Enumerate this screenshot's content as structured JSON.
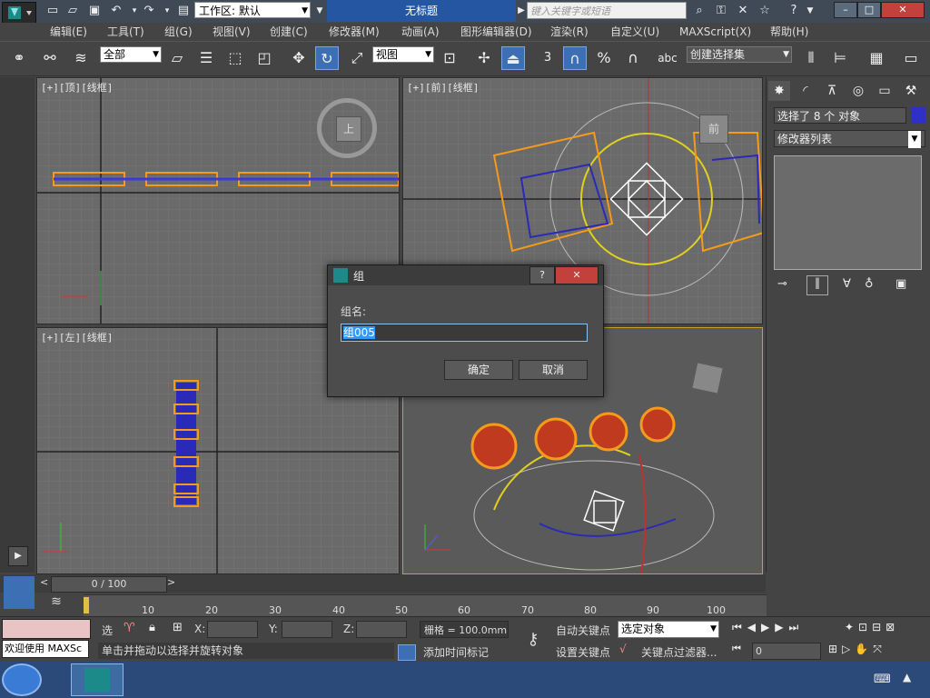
{
  "title_bar": {
    "workspace_label": "工作区: 默认",
    "window_title": "无标题",
    "search_placeholder": "键入关键字或短语",
    "minimize": "–",
    "maximize": "□",
    "close": "✕"
  },
  "menu": [
    "编辑(E)",
    "工具(T)",
    "组(G)",
    "视图(V)",
    "创建(C)",
    "修改器(M)",
    "动画(A)",
    "图形编辑器(D)",
    "渲染(R)",
    "自定义(U)",
    "MAXScript(X)",
    "帮助(H)"
  ],
  "toolbar": {
    "filter": "全部",
    "ref_coord": "视图",
    "selection_set": "创建选择集",
    "angle_snap": "3"
  },
  "viewports": {
    "top": "[+][顶][线框]",
    "front": "[+][前][线框]",
    "left": "[+][左][线框]",
    "viewcube_top": "上",
    "viewcube_front": "前"
  },
  "command_panel": {
    "selection_status": "选择了 8 个 对象",
    "modifier_list": "修改器列表"
  },
  "dialog": {
    "title": "组",
    "label": "组名:",
    "value": "组005",
    "ok": "确定",
    "cancel": "取消",
    "help": "?",
    "close": "✕"
  },
  "timeline": {
    "frame": "0 / 100",
    "ticks": [
      "10",
      "20",
      "30",
      "40",
      "50",
      "60",
      "70",
      "80",
      "90",
      "100"
    ]
  },
  "status_bar": {
    "welcome": "欢迎使用 MAXSc",
    "prompt": "单击并拖动以选择并旋转对象",
    "select_label": "选",
    "x_label": "X:",
    "y_label": "Y:",
    "z_label": "Z:",
    "grid": "栅格 = 100.0mm",
    "add_time_tag": "添加时间标记",
    "auto_key": "自动关键点",
    "set_key": "设置关键点",
    "key_target": "选定对象",
    "key_filters": "关键点过滤器...",
    "frame_value": "0"
  },
  "colors": {
    "accent": "#2456a2",
    "selection": "#f59a1b",
    "viewport": "#6a6a6a"
  }
}
